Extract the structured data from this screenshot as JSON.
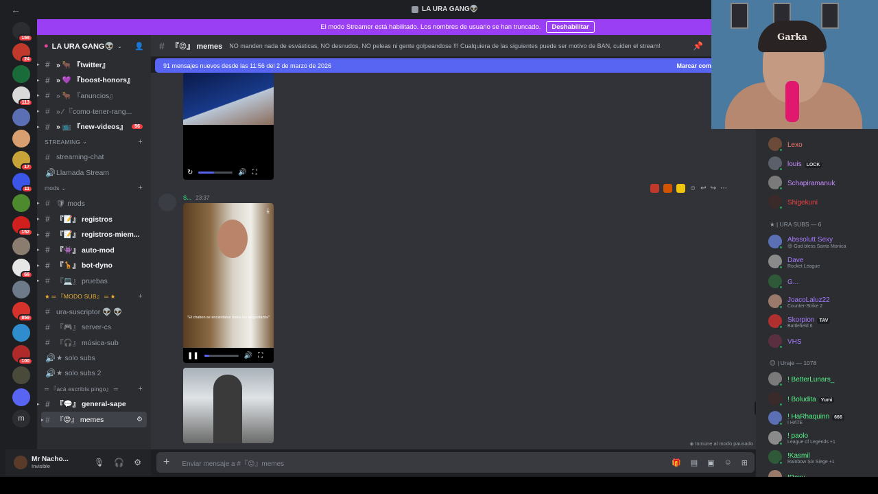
{
  "titlebar": {
    "title": "LA URA GANG👽"
  },
  "banner": {
    "text": "El modo Streamer está habilitado. Los nombres de usuario se han truncado.",
    "button": "Deshabilitar"
  },
  "servers": [
    {
      "badge": "158",
      "color": "#2b2d31"
    },
    {
      "badge": "24",
      "color": "#c0392b"
    },
    {
      "badge": "",
      "color": "#1a6b3a"
    },
    {
      "badge": "113",
      "color": "#d9d9d9"
    },
    {
      "badge": "",
      "color": "#5a6fb4"
    },
    {
      "badge": "",
      "color": "#d8a070"
    },
    {
      "badge": "17",
      "color": "#c8a33a"
    },
    {
      "badge": "11",
      "color": "#3b55e6"
    },
    {
      "badge": "",
      "color": "#4c8a2d"
    },
    {
      "badge": "152",
      "color": "#d0201e"
    },
    {
      "badge": "",
      "color": "#8a7d70"
    },
    {
      "badge": "66",
      "color": "#e6e6e6"
    },
    {
      "badge": "",
      "color": "#6c7a8a"
    },
    {
      "badge": "859",
      "color": "#d6322c"
    },
    {
      "badge": "",
      "color": "#2f8ccd"
    },
    {
      "badge": "100",
      "color": "#b02a2a"
    },
    {
      "badge": "",
      "color": "#4a4a3a"
    },
    {
      "badge": "",
      "color": "#5865f2"
    },
    {
      "badge": "",
      "label": "m",
      "color": "#2b2d31"
    }
  ],
  "guild": {
    "name": "LA URA GANG👽"
  },
  "channels_top": [
    {
      "label": "» 🐂 『twitter』",
      "unread": true,
      "badge": ""
    },
    {
      "label": "» 💜 『boost-honors』",
      "unread": true,
      "badge": ""
    },
    {
      "label": "» 🐂 『anuncios』",
      "unread": false,
      "badge": ""
    },
    {
      "label": "» ⁄ 『como-tener-rang...",
      "unread": false,
      "badge": ""
    },
    {
      "label": "» 📺 『new-videos』",
      "unread": true,
      "badge": "56"
    }
  ],
  "cat_streaming": "STREAMING",
  "channels_streaming": [
    {
      "label": "streaming-chat",
      "icon": "#"
    },
    {
      "label": "Llamada Stream",
      "icon": "🔊"
    }
  ],
  "cat_mods": "mods",
  "channels_mods": [
    {
      "label": "🛡 mods",
      "unread": false
    },
    {
      "label": "『📝』 registros",
      "unread": true
    },
    {
      "label": "『📝』 registros-miem...",
      "unread": true
    },
    {
      "label": "『👾』 auto-mod",
      "unread": true
    },
    {
      "label": "『🦒』 bot-dyno",
      "unread": true
    },
    {
      "label": "『💻』 pruebas",
      "unread": false
    }
  ],
  "cat_modo_sub": "★ ═ 『MODO SUB』 ═ ★",
  "channels_sub": [
    {
      "label": "ura-suscriptor 👽 👽",
      "icon": "#"
    },
    {
      "label": "『🎮』 server-cs",
      "icon": "#"
    },
    {
      "label": "『🎧』 música-sub",
      "icon": "#"
    },
    {
      "label": "★ solo subs",
      "icon": "🔊"
    },
    {
      "label": "★ solo subs 2",
      "icon": "🔊"
    }
  ],
  "cat_pingo": "═ 『acá escribís pingo』 ═",
  "channels_pingo": [
    {
      "label": "『💬』 general-sape",
      "unread": true
    },
    {
      "label": "『😡』 memes",
      "active": true
    }
  ],
  "user": {
    "name": "Mr Nacho...",
    "status": "Invisible"
  },
  "header": {
    "channel": "『😡』 memes",
    "topic": "NO manden nada de esvásticas, NO desnudos, NO peleas ni gente golpeandose !!! Cualquiera de las siguientes puede ser motivo de BAN, cuiden el stream!"
  },
  "newbar": {
    "text": "91 mensajes nuevos desde las 11:56 del 2 de marzo de 2026",
    "mark": "Marcar com"
  },
  "message": {
    "author": "S...",
    "time": "23:37"
  },
  "videos": [
    {
      "progress": 0.45,
      "caption": ""
    },
    {
      "progress": 0.15,
      "caption": "\"El chabon se encandalux todos los langostazos\""
    }
  ],
  "chat_footer": {
    "immune": "Inmune al modo pausado"
  },
  "composer": {
    "placeholder": "Enviar mensaje a #『😡』memes"
  },
  "members_top": [
    {
      "name": "Lexo",
      "color": "#f47b67",
      "tag": "",
      "sub": ""
    },
    {
      "name": "louis",
      "color": "#c88cff",
      "tag": "LOCK",
      "sub": ""
    },
    {
      "name": "Schapiramanuk",
      "color": "#c88cff",
      "tag": "",
      "sub": ""
    },
    {
      "name": "Shigekuni",
      "color": "#f23f42",
      "tag": "",
      "sub": ""
    }
  ],
  "group_subs": "★ | URA SUBS — 6",
  "members_subs": [
    {
      "name": "Abssolutt Sexy",
      "color": "#a77bff",
      "sub": "😊 God bless Santa Monica",
      "tag": ""
    },
    {
      "name": "Dave",
      "color": "#a77bff",
      "sub": "Rocket League",
      "tag": ""
    },
    {
      "name": "G...",
      "color": "#a77bff",
      "sub": "",
      "tag": ""
    },
    {
      "name": "JoacoLaluz22",
      "color": "#a77bff",
      "sub": "Counter-Strike 2",
      "tag": ""
    },
    {
      "name": "Skorpion",
      "color": "#a77bff",
      "sub": "Battlefield 6",
      "tag": "TAV"
    },
    {
      "name": "VHS",
      "color": "#a77bff",
      "sub": "",
      "tag": ""
    }
  ],
  "group_uraje": "😊 | Uraje — 1078",
  "members_uraje": [
    {
      "name": "! BetterLunars_",
      "color": "#57f287",
      "sub": "",
      "tag": ""
    },
    {
      "name": "! Boludita",
      "color": "#57f287",
      "sub": "",
      "tag": "Yumi"
    },
    {
      "name": "! HaRhaquinn",
      "color": "#57f287",
      "sub": "I HATE",
      "tag": "666"
    },
    {
      "name": "! paolo",
      "color": "#57f287",
      "sub": "League of Legends +1",
      "tag": ""
    },
    {
      "name": "!Kasmil",
      "color": "#57f287",
      "sub": "Rainbow Six Siege +1",
      "tag": ""
    },
    {
      "name": "!Roxy",
      "color": "#57f287",
      "sub": "",
      "tag": ""
    }
  ],
  "webcam": {
    "cap_text": "Garka"
  }
}
